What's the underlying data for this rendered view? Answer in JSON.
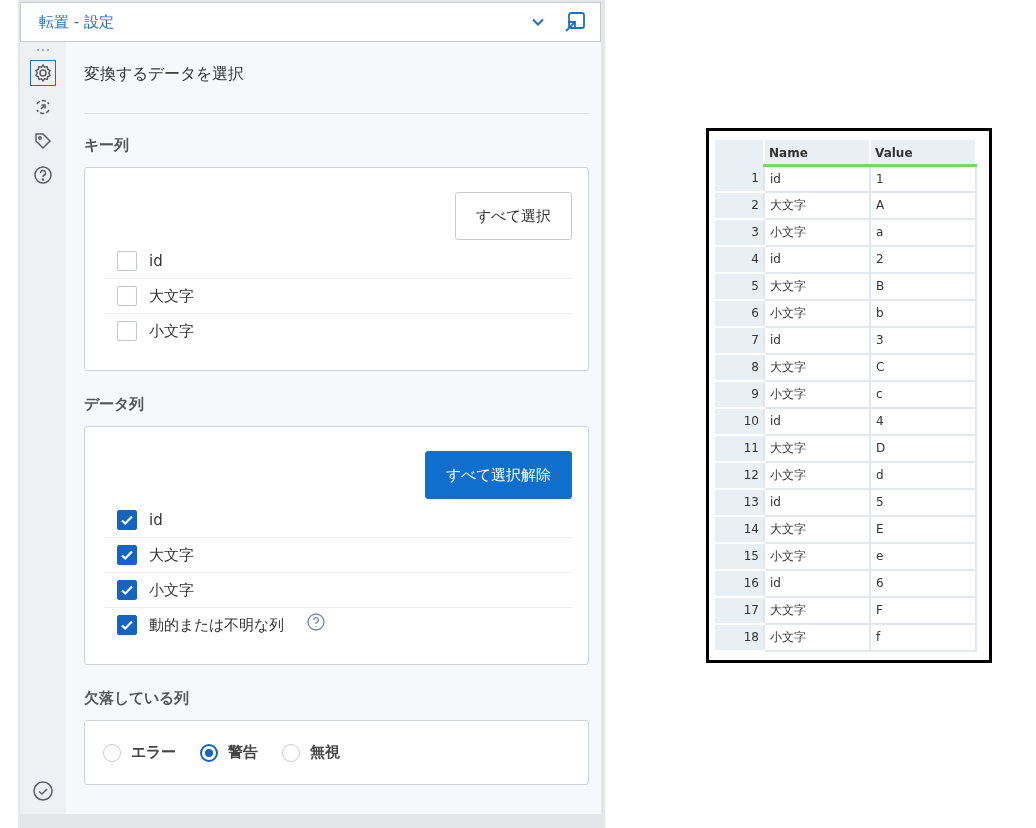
{
  "window": {
    "title": "転置 - 設定"
  },
  "sidebar": {
    "items": [
      {
        "kind": "gear",
        "selected": true
      },
      {
        "kind": "arrow",
        "selected": false
      },
      {
        "kind": "tag",
        "selected": false
      },
      {
        "kind": "help",
        "selected": false
      }
    ]
  },
  "heading": "変換するデータを選択",
  "sections": [
    {
      "title": "キー列",
      "button": {
        "label": "すべて選択",
        "kind": "outline"
      },
      "options": [
        {
          "label": "id",
          "checked": false
        },
        {
          "label": "大文字",
          "checked": false
        },
        {
          "label": "小文字",
          "checked": false
        }
      ]
    },
    {
      "title": "データ列",
      "button": {
        "label": "すべて選択解除",
        "kind": "primary"
      },
      "options": [
        {
          "label": "id",
          "checked": true
        },
        {
          "label": "大文字",
          "checked": true
        },
        {
          "label": "小文字",
          "checked": true
        },
        {
          "label": "動的または不明な列",
          "checked": true,
          "help": true
        }
      ]
    }
  ],
  "missing": {
    "title": "欠落している列",
    "choices": [
      {
        "label": "エラー",
        "selected": false
      },
      {
        "label": "警告",
        "selected": true
      },
      {
        "label": "無視",
        "selected": false
      }
    ]
  },
  "table": {
    "columns": [
      "",
      "Name",
      "Value"
    ],
    "rows": [
      [
        "1",
        "id",
        "1"
      ],
      [
        "2",
        "大文字",
        "A"
      ],
      [
        "3",
        "小文字",
        "a"
      ],
      [
        "4",
        "id",
        "2"
      ],
      [
        "5",
        "大文字",
        "B"
      ],
      [
        "6",
        "小文字",
        "b"
      ],
      [
        "7",
        "id",
        "3"
      ],
      [
        "8",
        "大文字",
        "C"
      ],
      [
        "9",
        "小文字",
        "c"
      ],
      [
        "10",
        "id",
        "4"
      ],
      [
        "11",
        "大文字",
        "D"
      ],
      [
        "12",
        "小文字",
        "d"
      ],
      [
        "13",
        "id",
        "5"
      ],
      [
        "14",
        "大文字",
        "E"
      ],
      [
        "15",
        "小文字",
        "e"
      ],
      [
        "16",
        "id",
        "6"
      ],
      [
        "17",
        "大文字",
        "F"
      ],
      [
        "18",
        "小文字",
        "f"
      ]
    ]
  }
}
